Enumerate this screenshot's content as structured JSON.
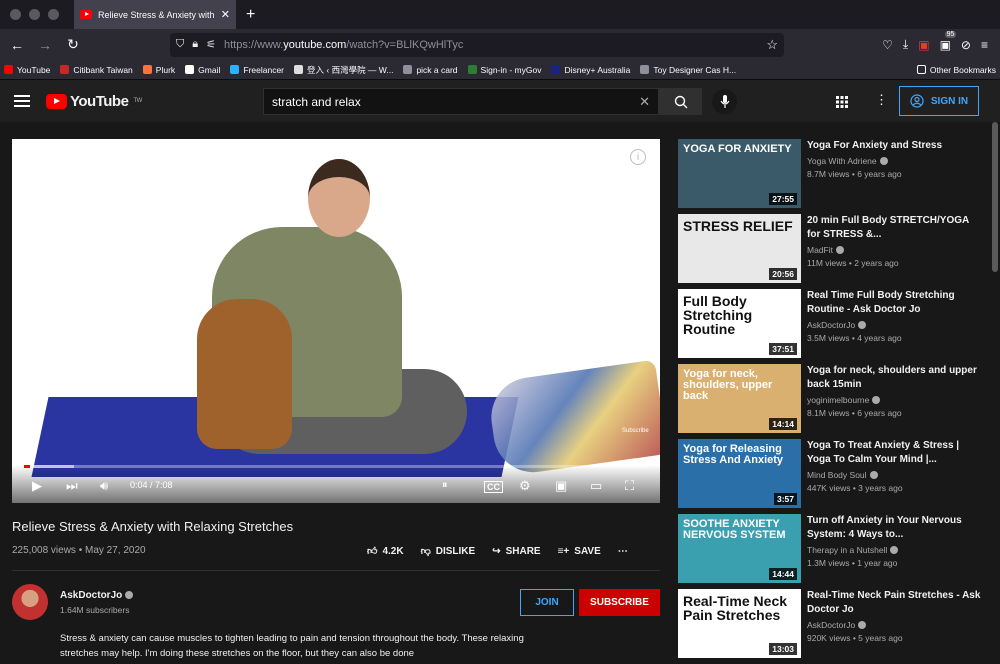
{
  "browser": {
    "tab_title": "Relieve Stress & Anxiety with Relaxing Stretches",
    "url_prefix": "https://www.",
    "url_domain": "youtube.com",
    "url_path": "/watch?v=BLlKQwHlTyc",
    "badge_count": "95",
    "bookmarks": [
      {
        "label": "YouTube",
        "color": "#ff0000"
      },
      {
        "label": "Citibank Taiwan",
        "color": "#c62828"
      },
      {
        "label": "Plurk",
        "color": "#ff7043"
      },
      {
        "label": "Gmail",
        "color": "#ffffff"
      },
      {
        "label": "Freelancer",
        "color": "#29b2fe"
      },
      {
        "label": "登入 ‹ 西灣學院 — W...",
        "color": "#dddddd"
      },
      {
        "label": "pick a card",
        "color": "#8f8f9d"
      },
      {
        "label": "Sign-in - myGov",
        "color": "#2e7d32"
      },
      {
        "label": "Disney+ Australia",
        "color": "#1a237e"
      },
      {
        "label": "Toy Designer Cas H...",
        "color": "#8f8f9d"
      }
    ],
    "other_bookmarks": "Other Bookmarks"
  },
  "header": {
    "logo_text": "YouTube",
    "logo_region": "TW",
    "search_value": "stratch and relax",
    "signin_label": "SIGN IN"
  },
  "player": {
    "time": "0:04 / 7:08",
    "progress": 0.01,
    "buffered": 0.08,
    "overlay_label": "Subscribe"
  },
  "video": {
    "title": "Relieve Stress & Anxiety with Relaxing Stretches",
    "meta": "225,008 views • May 27, 2020",
    "likes": "4.2K",
    "dislike": "DISLIKE",
    "share": "SHARE",
    "save": "SAVE"
  },
  "channel": {
    "name": "AskDoctorJo",
    "subs": "1.64M subscribers",
    "join": "JOIN",
    "subscribe": "SUBSCRIBE",
    "description": "Stress & anxiety can cause muscles to tighten leading to pain and tension throughout the body. These relaxing stretches may help. I'm doing these stretches on the floor, but they can also be done"
  },
  "recommended": [
    {
      "title": "Yoga For Anxiety and Stress",
      "channel": "Yoga With Adriene",
      "meta": "8.7M views • 6 years ago",
      "duration": "27:55",
      "thumb_text": "YOGA FOR ANXIETY",
      "bg": "#3a5a6a"
    },
    {
      "title": "20 min Full Body STRETCH/YOGA for STRESS &...",
      "channel": "MadFit",
      "meta": "11M views • 2 years ago",
      "duration": "20:56",
      "thumb_text": "STRESS    RELIEF",
      "bg": "#e8e8e8"
    },
    {
      "title": "Real Time Full Body Stretching Routine - Ask Doctor Jo",
      "channel": "AskDoctorJo",
      "meta": "3.5M views • 4 years ago",
      "duration": "37:51",
      "thumb_text": "Full Body Stretching Routine",
      "bg": "#ffffff"
    },
    {
      "title": "Yoga for neck, shoulders and upper back 15min",
      "channel": "yoginimelbourne",
      "meta": "8.1M views • 6 years ago",
      "duration": "14:14",
      "thumb_text": "Yoga for neck, shoulders, upper back",
      "bg": "#d9b070"
    },
    {
      "title": "Yoga To Treat Anxiety & Stress | Yoga To Calm Your Mind |...",
      "channel": "Mind Body Soul",
      "meta": "447K views • 3 years ago",
      "duration": "3:57",
      "thumb_text": "Yoga for Releasing Stress And Anxiety",
      "bg": "#2a6fa8"
    },
    {
      "title": "Turn off Anxiety in Your Nervous System: 4 Ways to...",
      "channel": "Therapy in a Nutshell",
      "meta": "1.3M views • 1 year ago",
      "duration": "14:44",
      "thumb_text": "SOOTHE ANXIETY NERVOUS SYSTEM",
      "bg": "#3aa0b0"
    },
    {
      "title": "Real-Time Neck Pain Stretches - Ask Doctor Jo",
      "channel": "AskDoctorJo",
      "meta": "920K views • 5 years ago",
      "duration": "13:03",
      "thumb_text": "Real-Time Neck Pain Stretches",
      "bg": "#ffffff"
    }
  ]
}
